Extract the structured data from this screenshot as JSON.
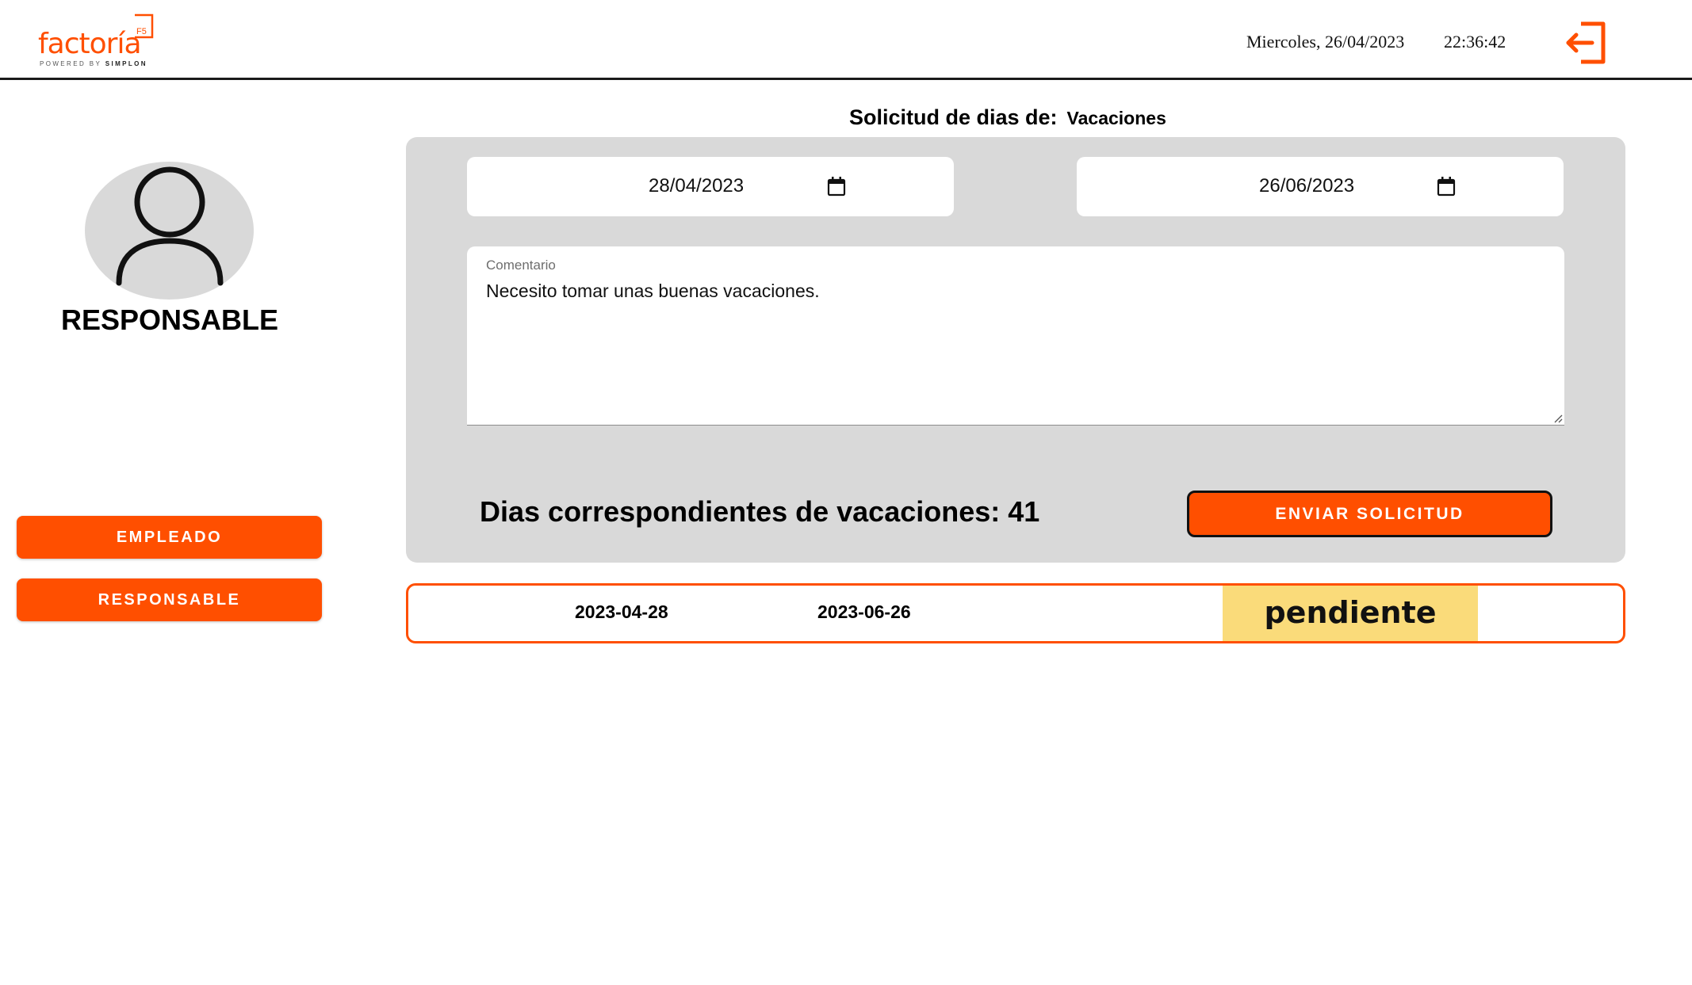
{
  "header": {
    "logo_word": "factoría",
    "logo_badge": "F5",
    "logo_tagline_pre": "POWERED BY ",
    "logo_tagline_brand": "SIMPLON",
    "date": "Miercoles, 26/04/2023",
    "time": "22:36:42",
    "logout_icon": "logout-icon"
  },
  "sidebar": {
    "avatar_icon": "user-icon",
    "role": "RESPONSABLE",
    "buttons": [
      {
        "label": "EMPLEADO"
      },
      {
        "label": "RESPONSABLE"
      }
    ]
  },
  "request_form": {
    "title": "Solicitud de dias de:",
    "type": "Vacaciones",
    "start_date": "28/04/2023",
    "end_date": "26/06/2023",
    "date_icon": "calendar-icon",
    "comment_label": "Comentario",
    "comment_value": "Necesito tomar unas buenas vacaciones.",
    "days_text": "Dias correspondientes de vacaciones: 41",
    "submit_label": "ENVIAR SOLICITUD"
  },
  "requests": [
    {
      "start": "2023-04-28",
      "end": "2023-06-26",
      "status": "pendiente"
    }
  ],
  "colors": {
    "accent": "#ff4f00",
    "panel": "#d9d9d9",
    "status_pending": "#fadb7a"
  }
}
